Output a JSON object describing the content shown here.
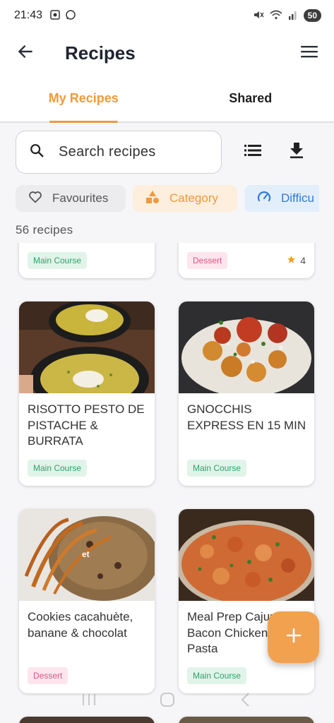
{
  "status_bar": {
    "time": "21:43",
    "battery": "50",
    "left_icons": [
      "screenshot-icon",
      "whatsapp-icon"
    ],
    "right_icons": [
      "mute-icon",
      "wifi-icon",
      "signal-icon"
    ]
  },
  "app_bar": {
    "title": "Recipes",
    "back_icon": "arrow-left-icon",
    "menu_icon": "hamburger-menu-icon"
  },
  "tabs": [
    {
      "label": "My Recipes",
      "active": true
    },
    {
      "label": "Shared",
      "active": false
    }
  ],
  "search": {
    "placeholder": "Search recipes",
    "value": ""
  },
  "toolbar": {
    "list_view_icon": "list-view-icon",
    "download_icon": "download-icon"
  },
  "filters": [
    {
      "label": "Favourites",
      "icon": "heart-outline-icon"
    },
    {
      "label": "Category",
      "icon": "category-shapes-icon"
    },
    {
      "label": "Difficu",
      "icon": "gauge-icon"
    }
  ],
  "recipe_count": "56 recipes",
  "cards": [
    {
      "title": "",
      "category": "Main Course",
      "category_type": "main"
    },
    {
      "title": "",
      "category": "Dessert",
      "category_type": "dessert",
      "rating": "4"
    },
    {
      "title": "RISOTTO PESTO DE PISTACHE & BURRATA",
      "category": "Main Course",
      "category_type": "main"
    },
    {
      "title": "GNOCCHIS EXPRESS EN 15 MIN",
      "category": "Main Course",
      "category_type": "main"
    },
    {
      "title": "Cookies cacahuète, banane & chocolat",
      "category": "Dessert",
      "category_type": "dessert",
      "image_caption": "et"
    },
    {
      "title": "Meal Prep Cajun Bacon Chicken Ranch Pasta",
      "category": "Main Course",
      "category_type": "main"
    }
  ],
  "fab": {
    "icon": "plus-icon"
  },
  "colors": {
    "accent": "#ef9a3c",
    "main_course_badge": "#2ba36b",
    "dessert_badge": "#e0557f",
    "difficulty_chip": "#2f7ad8"
  }
}
